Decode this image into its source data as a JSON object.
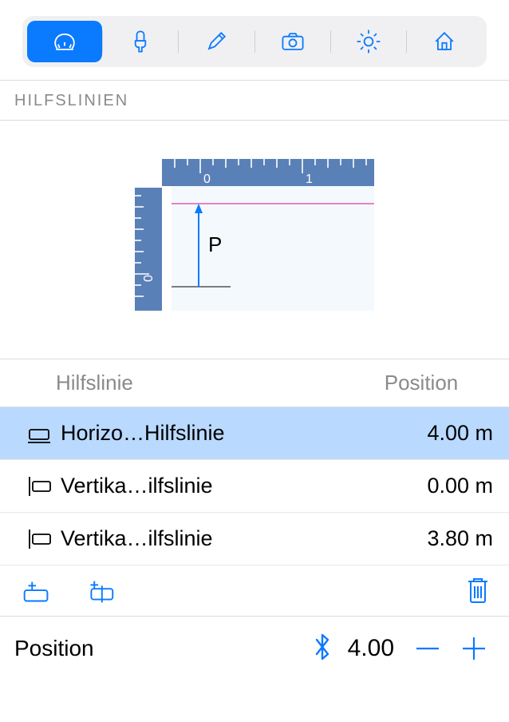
{
  "toolbar": {
    "active_index": 0,
    "icons": [
      "ruler-fan-icon",
      "paintbrush-icon",
      "pencil-icon",
      "camera-icon",
      "sun-icon",
      "house-icon"
    ]
  },
  "section": {
    "title": "HILFSLINIEN"
  },
  "diagram": {
    "p_label": "P",
    "top_tick_labels": [
      "0",
      "1"
    ],
    "left_tick_label": "0"
  },
  "table": {
    "columns": {
      "name": "Hilfslinie",
      "position": "Position"
    },
    "rows": [
      {
        "orientation": "h",
        "name": "Horizo…Hilfslinie",
        "position": "4.00 m",
        "selected": true
      },
      {
        "orientation": "v",
        "name": "Vertika…ilfslinie",
        "position": "0.00 m",
        "selected": false
      },
      {
        "orientation": "v",
        "name": "Vertika…ilfslinie",
        "position": "3.80 m",
        "selected": false
      }
    ]
  },
  "actions": {
    "add_horizontal": "add-horizontal-guide",
    "add_vertical": "add-vertical-guide",
    "delete": "delete-guide"
  },
  "position_editor": {
    "label": "Position",
    "value": "4.00",
    "bluetooth": true
  }
}
